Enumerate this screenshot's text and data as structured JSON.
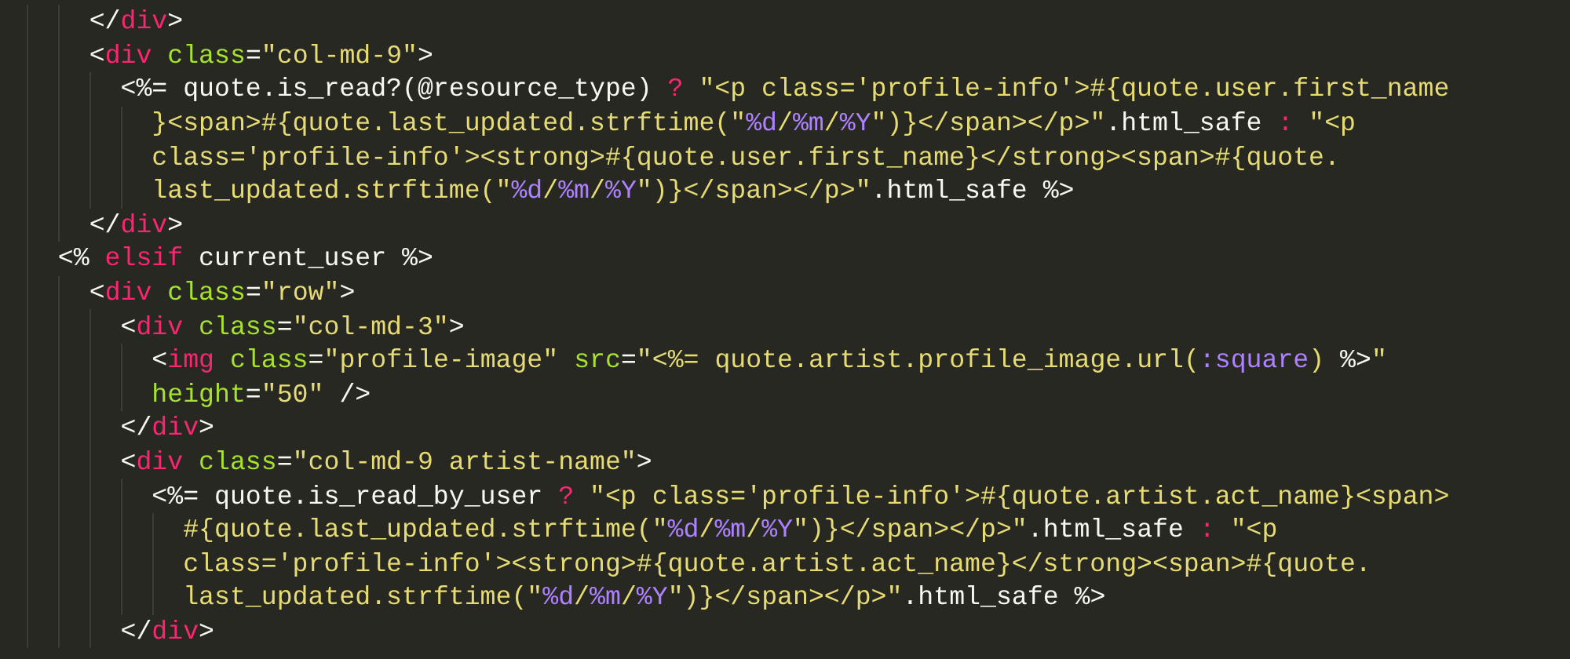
{
  "editor": {
    "lines": [
      {
        "tokens": [
          {
            "kind": "punct",
            "text": "    </"
          },
          {
            "kind": "tag",
            "text": "div"
          },
          {
            "kind": "punct",
            "text": ">"
          }
        ]
      },
      {
        "tokens": [
          {
            "kind": "punct",
            "text": "    <"
          },
          {
            "kind": "tag",
            "text": "div"
          },
          {
            "kind": "attr",
            "text": " class"
          },
          {
            "kind": "punct",
            "text": "="
          },
          {
            "kind": "string",
            "text": "\"col-md-9\""
          },
          {
            "kind": "punct",
            "text": ">"
          }
        ]
      },
      {
        "tokens": [
          {
            "kind": "punct",
            "text": "      <%="
          },
          {
            "kind": "plain",
            "text": " quote.is_read?(@resource_type) "
          },
          {
            "kind": "operator",
            "text": "?"
          },
          {
            "kind": "string",
            "text": " \"<p class='profile-info'>#{quote.user.first_name"
          }
        ]
      },
      {
        "tokens": [
          {
            "kind": "string",
            "text": "        }<span>#{quote.last_updated.strftime(\""
          },
          {
            "kind": "constant",
            "text": "%d"
          },
          {
            "kind": "string",
            "text": "/"
          },
          {
            "kind": "constant",
            "text": "%m"
          },
          {
            "kind": "string",
            "text": "/"
          },
          {
            "kind": "constant",
            "text": "%Y"
          },
          {
            "kind": "string",
            "text": "\")}</span></p>\""
          },
          {
            "kind": "plain",
            "text": ".html_safe "
          },
          {
            "kind": "operator",
            "text": ":"
          },
          {
            "kind": "string",
            "text": " \"<p"
          }
        ]
      },
      {
        "tokens": [
          {
            "kind": "string",
            "text": "        class='profile-info'><strong>#{quote.user.first_name}</strong><span>#{quote."
          }
        ]
      },
      {
        "tokens": [
          {
            "kind": "string",
            "text": "        last_updated.strftime(\""
          },
          {
            "kind": "constant",
            "text": "%d"
          },
          {
            "kind": "string",
            "text": "/"
          },
          {
            "kind": "constant",
            "text": "%m"
          },
          {
            "kind": "string",
            "text": "/"
          },
          {
            "kind": "constant",
            "text": "%Y"
          },
          {
            "kind": "string",
            "text": "\")}</span></p>\""
          },
          {
            "kind": "plain",
            "text": ".html_safe %>"
          }
        ]
      },
      {
        "tokens": [
          {
            "kind": "punct",
            "text": "    </"
          },
          {
            "kind": "tag",
            "text": "div"
          },
          {
            "kind": "punct",
            "text": ">"
          }
        ]
      },
      {
        "tokens": [
          {
            "kind": "punct",
            "text": "  <%"
          },
          {
            "kind": "operator",
            "text": " elsif"
          },
          {
            "kind": "plain",
            "text": " current_user %>"
          }
        ]
      },
      {
        "tokens": [
          {
            "kind": "punct",
            "text": "    <"
          },
          {
            "kind": "tag",
            "text": "div"
          },
          {
            "kind": "attr",
            "text": " class"
          },
          {
            "kind": "punct",
            "text": "="
          },
          {
            "kind": "string",
            "text": "\"row\""
          },
          {
            "kind": "punct",
            "text": ">"
          }
        ]
      },
      {
        "tokens": [
          {
            "kind": "punct",
            "text": "      <"
          },
          {
            "kind": "tag",
            "text": "div"
          },
          {
            "kind": "attr",
            "text": " class"
          },
          {
            "kind": "punct",
            "text": "="
          },
          {
            "kind": "string",
            "text": "\"col-md-3\""
          },
          {
            "kind": "punct",
            "text": ">"
          }
        ]
      },
      {
        "tokens": [
          {
            "kind": "punct",
            "text": "        <"
          },
          {
            "kind": "tag",
            "text": "img"
          },
          {
            "kind": "attr",
            "text": " class"
          },
          {
            "kind": "punct",
            "text": "="
          },
          {
            "kind": "string",
            "text": "\"profile-image\""
          },
          {
            "kind": "attr",
            "text": " src"
          },
          {
            "kind": "punct",
            "text": "="
          },
          {
            "kind": "string",
            "text": "\"<%= quote.artist.profile_image.url("
          },
          {
            "kind": "constant",
            "text": ":square"
          },
          {
            "kind": "string",
            "text": ")"
          },
          {
            "kind": "plain",
            "text": " %>"
          },
          {
            "kind": "string",
            "text": "\""
          }
        ]
      },
      {
        "tokens": [
          {
            "kind": "attr",
            "text": "        height"
          },
          {
            "kind": "punct",
            "text": "="
          },
          {
            "kind": "string",
            "text": "\"50\""
          },
          {
            "kind": "punct",
            "text": " />"
          }
        ]
      },
      {
        "tokens": [
          {
            "kind": "punct",
            "text": "      </"
          },
          {
            "kind": "tag",
            "text": "div"
          },
          {
            "kind": "punct",
            "text": ">"
          }
        ]
      },
      {
        "tokens": [
          {
            "kind": "punct",
            "text": "      <"
          },
          {
            "kind": "tag",
            "text": "div"
          },
          {
            "kind": "attr",
            "text": " class"
          },
          {
            "kind": "punct",
            "text": "="
          },
          {
            "kind": "string",
            "text": "\"col-md-9 artist-name\""
          },
          {
            "kind": "punct",
            "text": ">"
          }
        ]
      },
      {
        "tokens": [
          {
            "kind": "punct",
            "text": "        <%="
          },
          {
            "kind": "plain",
            "text": " quote.is_read_by_user "
          },
          {
            "kind": "operator",
            "text": "?"
          },
          {
            "kind": "string",
            "text": " \"<p class='profile-info'>#{quote.artist.act_name}<span>"
          }
        ]
      },
      {
        "tokens": [
          {
            "kind": "string",
            "text": "          #{quote.last_updated.strftime(\""
          },
          {
            "kind": "constant",
            "text": "%d"
          },
          {
            "kind": "string",
            "text": "/"
          },
          {
            "kind": "constant",
            "text": "%m"
          },
          {
            "kind": "string",
            "text": "/"
          },
          {
            "kind": "constant",
            "text": "%Y"
          },
          {
            "kind": "string",
            "text": "\")}</span></p>\""
          },
          {
            "kind": "plain",
            "text": ".html_safe "
          },
          {
            "kind": "operator",
            "text": ":"
          },
          {
            "kind": "string",
            "text": " \"<p"
          }
        ]
      },
      {
        "tokens": [
          {
            "kind": "string",
            "text": "          class='profile-info'><strong>#{quote.artist.act_name}</strong><span>#{quote."
          }
        ]
      },
      {
        "tokens": [
          {
            "kind": "string",
            "text": "          last_updated.strftime(\""
          },
          {
            "kind": "constant",
            "text": "%d"
          },
          {
            "kind": "string",
            "text": "/"
          },
          {
            "kind": "constant",
            "text": "%m"
          },
          {
            "kind": "string",
            "text": "/"
          },
          {
            "kind": "constant",
            "text": "%Y"
          },
          {
            "kind": "string",
            "text": "\")}</span></p>\""
          },
          {
            "kind": "plain",
            "text": ".html_safe %>"
          }
        ]
      },
      {
        "tokens": [
          {
            "kind": "punct",
            "text": "      </"
          },
          {
            "kind": "tag",
            "text": "div"
          },
          {
            "kind": "punct",
            "text": ">"
          }
        ]
      }
    ]
  }
}
